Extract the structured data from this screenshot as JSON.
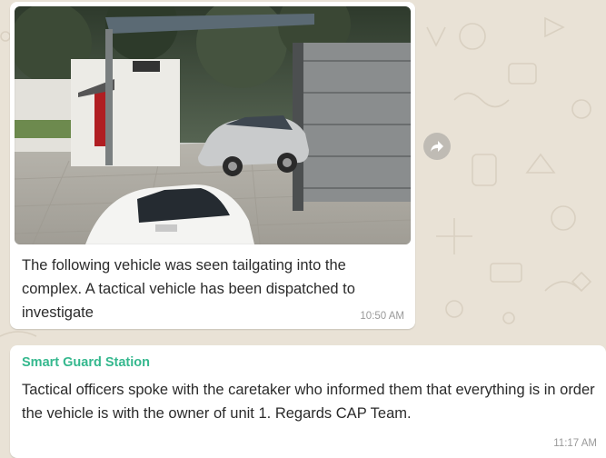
{
  "chat": {
    "messages": [
      {
        "text": "The following vehicle was seen tailgating into the complex. A tactical vehicle has been dispatched to investigate",
        "time": "10:50 AM",
        "image_alt": "CCTV still: silver car entering the complex gate behind a white car"
      },
      {
        "sender": "Smart Guard Station",
        "text": "Tactical officers spoke with the caretaker who informed them that everything is in order the vehicle is with the owner of unit 1.  Regards CAP Team.",
        "time": "11:17 AM"
      }
    ],
    "forward_icon": "forward-icon"
  },
  "colors": {
    "wallpaper": "#e9e2d6",
    "bubble": "#ffffff",
    "sender_name": "#35b88e",
    "timestamp": "#9a9a9a"
  }
}
